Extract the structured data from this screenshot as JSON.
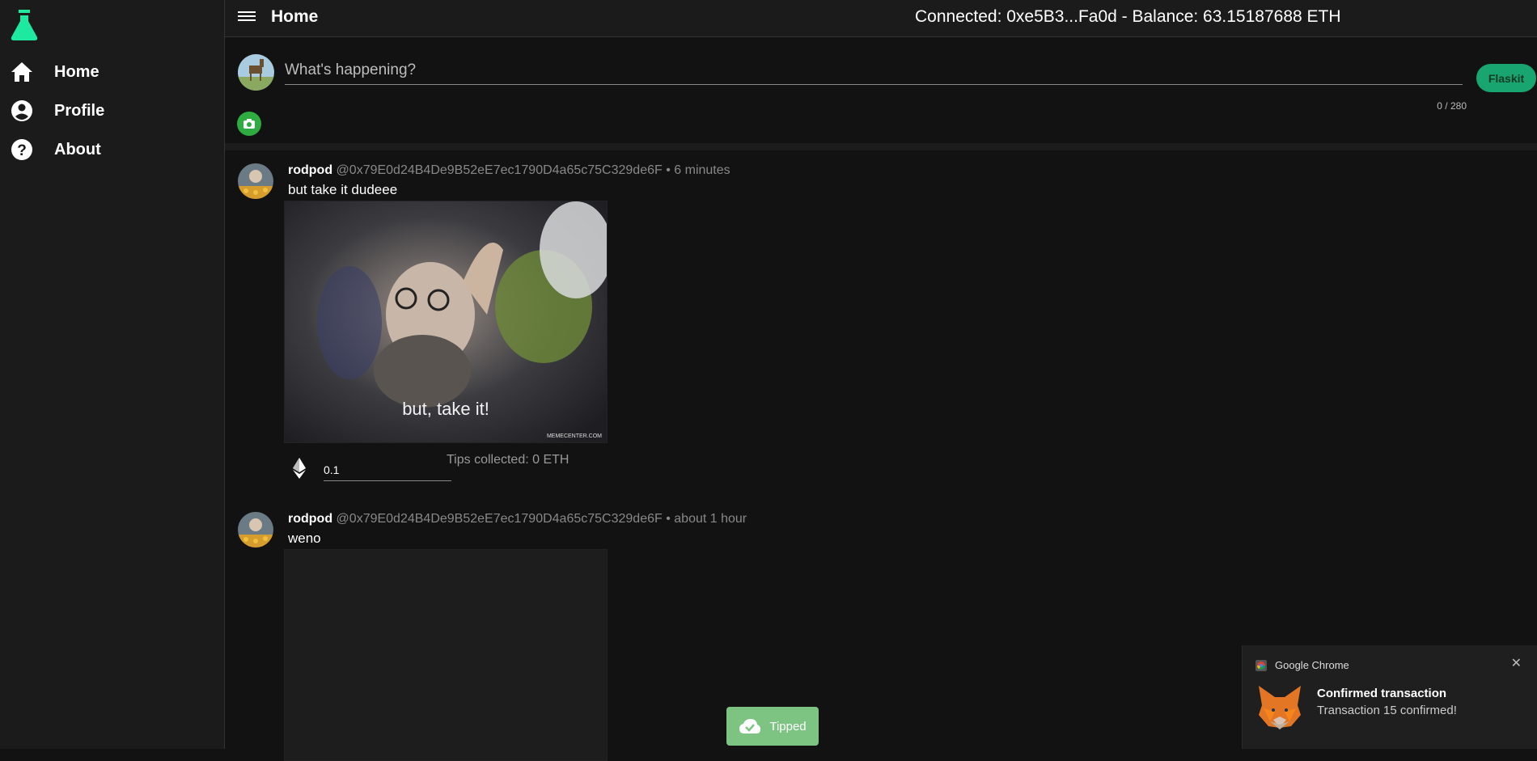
{
  "sidebar": {
    "logo_icon": "flask-icon",
    "items": [
      {
        "label": "Home",
        "icon": "home-icon"
      },
      {
        "label": "Profile",
        "icon": "account-circle-icon"
      },
      {
        "label": "About",
        "icon": "help-circle-icon"
      }
    ]
  },
  "header": {
    "title": "Home",
    "connection": "Connected: 0xe5B3...Fa0d - Balance: 63.15187688 ETH"
  },
  "composer": {
    "placeholder": "What's happening?",
    "char_count": "0 / 280",
    "submit_label": "Flaskit",
    "camera_icon": "camera-icon"
  },
  "posts": [
    {
      "username": "rodpod",
      "handle": "@0x79E0d24B4De9B52eE7ec1790D4a65c75C329de6F",
      "time": "6 minutes",
      "text": "but take it dudeee",
      "media_caption": "but, take it!",
      "media_watermark": "MEMECENTER.COM",
      "tip_value": "0.1",
      "tips_collected": "Tips collected: 0 ETH"
    },
    {
      "username": "rodpod",
      "handle": "@0x79E0d24B4De9B52eE7ec1790D4a65c75C329de6F",
      "time": "about 1 hour",
      "text": "weno"
    }
  ],
  "snackbar": {
    "label": "Tipped"
  },
  "notification": {
    "app": "Google Chrome",
    "title": "Confirmed transaction",
    "body": "Transaction 15 confirmed!",
    "close_glyph": "✕"
  },
  "colors": {
    "accent": "#18a56f",
    "logo": "#1de9a0",
    "camera": "#2eac42",
    "snackbar": "#7dc483"
  }
}
